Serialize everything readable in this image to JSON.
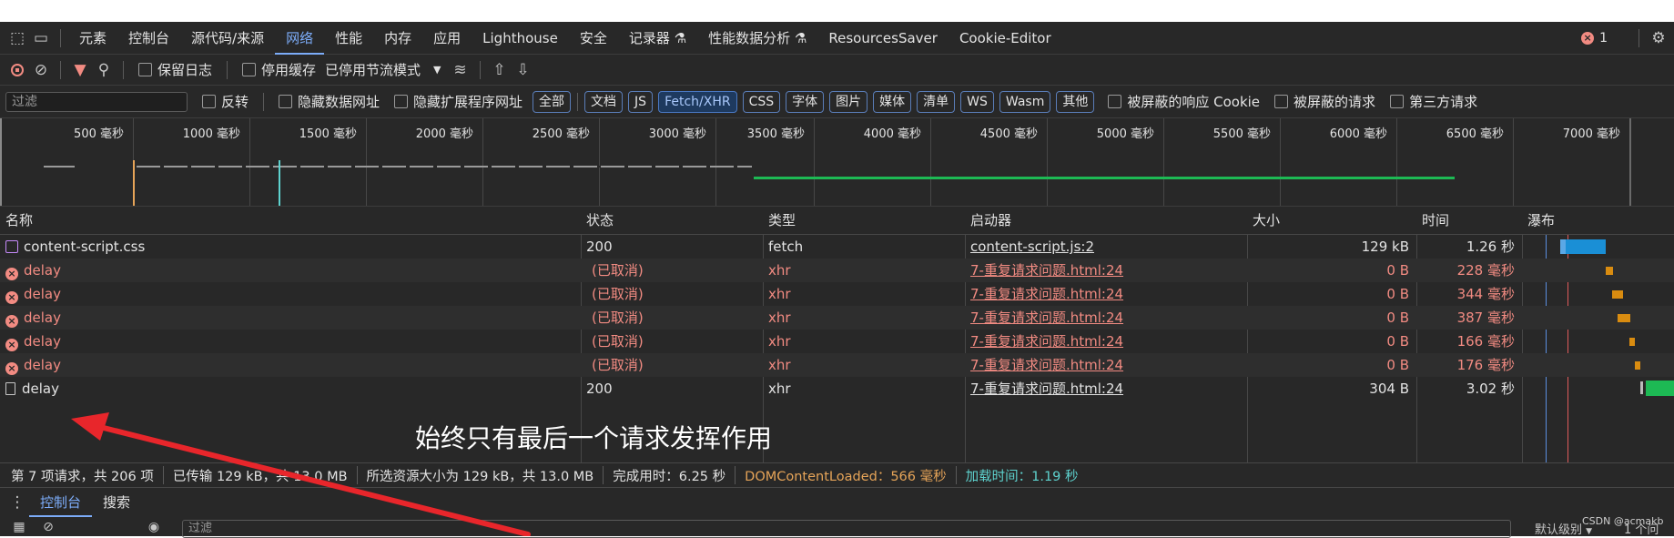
{
  "tabs": {
    "items": [
      "元素",
      "控制台",
      "源代码/来源",
      "网络",
      "性能",
      "内存",
      "应用",
      "Lighthouse",
      "安全",
      "记录器",
      "性能数据分析",
      "ResourcesSaver",
      "Cookie-Editor"
    ],
    "active": "网络",
    "recorder_flask": "⚗",
    "perf_flask": "⚗",
    "error_count": "1"
  },
  "toolbar": {
    "preserve_log": "保留日志",
    "disable_cache": "停用缓存",
    "throttling": "已停用节流模式"
  },
  "filterbar": {
    "placeholder": "过滤",
    "invert": "反转",
    "hide_data_urls": "隐藏数据网址",
    "hide_ext_urls": "隐藏扩展程序网址",
    "chips": [
      "全部",
      "文档",
      "JS",
      "Fetch/XHR",
      "CSS",
      "字体",
      "图片",
      "媒体",
      "清单",
      "WS",
      "Wasm",
      "其他"
    ],
    "active_chip": "Fetch/XHR",
    "blocked_cookies": "被屏蔽的响应 Cookie",
    "blocked_requests": "被屏蔽的请求",
    "third_party": "第三方请求"
  },
  "overview": {
    "ticks": [
      "500 毫秒",
      "1000 毫秒",
      "1500 毫秒",
      "2000 毫秒",
      "2500 毫秒",
      "3000 毫秒",
      "3500 毫秒",
      "4000 毫秒",
      "4500 毫秒",
      "5000 毫秒",
      "5500 毫秒",
      "6000 毫秒",
      "6500 毫秒",
      "7000 毫秒"
    ]
  },
  "columns": {
    "name": "名称",
    "status": "状态",
    "type": "类型",
    "initiator": "启动器",
    "size": "大小",
    "time": "时间",
    "waterfall": "瀑布"
  },
  "rows": [
    {
      "name": "content-script.css",
      "status": "200",
      "type": "fetch",
      "initiator": "content-script.js:2",
      "size": "129 kB",
      "time": "1.26 秒",
      "kind": "css",
      "error": false
    },
    {
      "name": "delay",
      "status": "(已取消)",
      "type": "xhr",
      "initiator": "7-重复请求问题.html:24",
      "size": "0 B",
      "time": "228 毫秒",
      "kind": "xhr",
      "error": true
    },
    {
      "name": "delay",
      "status": "(已取消)",
      "type": "xhr",
      "initiator": "7-重复请求问题.html:24",
      "size": "0 B",
      "time": "344 毫秒",
      "kind": "xhr",
      "error": true
    },
    {
      "name": "delay",
      "status": "(已取消)",
      "type": "xhr",
      "initiator": "7-重复请求问题.html:24",
      "size": "0 B",
      "time": "387 毫秒",
      "kind": "xhr",
      "error": true
    },
    {
      "name": "delay",
      "status": "(已取消)",
      "type": "xhr",
      "initiator": "7-重复请求问题.html:24",
      "size": "0 B",
      "time": "166 毫秒",
      "kind": "xhr",
      "error": true
    },
    {
      "name": "delay",
      "status": "(已取消)",
      "type": "xhr",
      "initiator": "7-重复请求问题.html:24",
      "size": "0 B",
      "time": "176 毫秒",
      "kind": "xhr",
      "error": true
    },
    {
      "name": "delay",
      "status": "200",
      "type": "xhr",
      "initiator": "7-重复请求问题.html:24",
      "size": "304 B",
      "time": "3.02 秒",
      "kind": "doc",
      "error": false
    }
  ],
  "statusbar": {
    "requests": "第 7 项请求，共 206 项",
    "transferred": "已传输 129 kB，共 13.0 MB",
    "resources": "所选资源大小为 129 kB，共 13.0 MB",
    "finish": "完成用时：6.25 秒",
    "dcl": "DOMContentLoaded：566 毫秒",
    "load": "加载时间：1.19 秒"
  },
  "drawer": {
    "tabs": [
      "控制台",
      "搜索"
    ],
    "active": "控制台",
    "filter_placeholder": "过滤",
    "levels": "默认级别",
    "issues": "1 个问"
  },
  "annotation": "始终只有最后一个请求发挥作用",
  "watermark": "CSDN @acmakb",
  "colors": {
    "accent": "#7cacf8",
    "error": "#f28b82",
    "dcl": "#e6a458",
    "load": "#5ed3cf",
    "arrow": "#e8262b"
  }
}
